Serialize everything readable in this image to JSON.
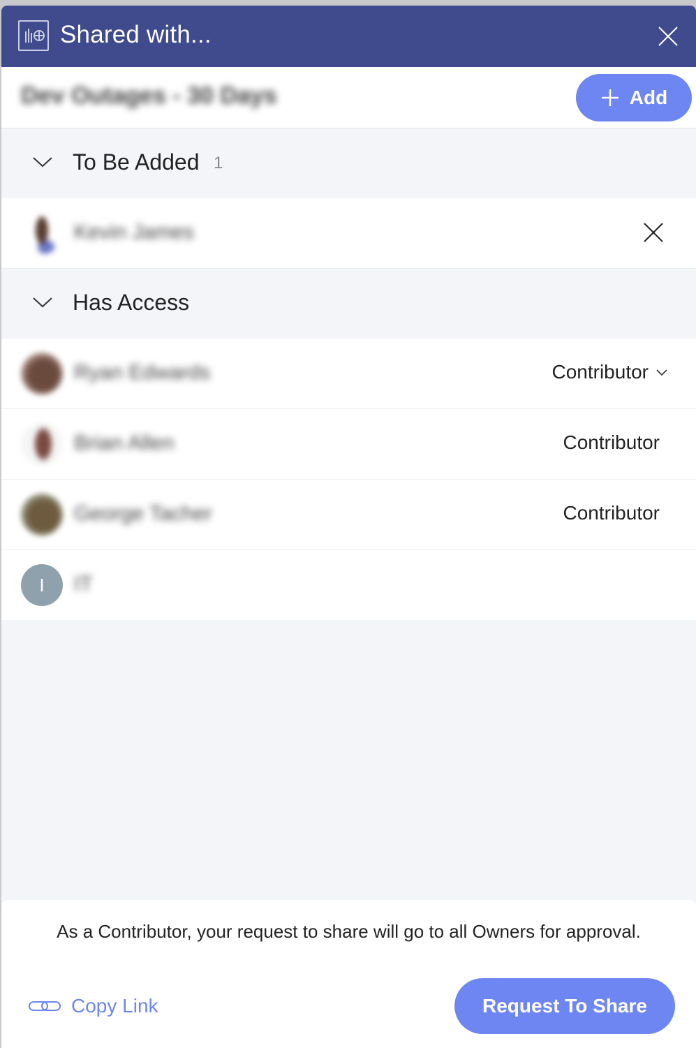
{
  "dialog": {
    "title": "Shared with...",
    "dashboard_name": "Dev Outages - 30 Days"
  },
  "add_button": {
    "label": "Add"
  },
  "sections": {
    "to_be_added": {
      "title": "To Be Added",
      "count": "1"
    },
    "has_access": {
      "title": "Has Access"
    }
  },
  "to_be_added_users": [
    {
      "name": "Kevin James"
    }
  ],
  "has_access_users": [
    {
      "name": "Ryan Edwards",
      "role": "Contributor",
      "dropdown": true
    },
    {
      "name": "Brian Allen",
      "role": "Contributor",
      "dropdown": false
    },
    {
      "name": "George Tacher",
      "role": "Contributor",
      "dropdown": false
    },
    {
      "name": "IT",
      "initial": "I",
      "role": ""
    }
  ],
  "footer": {
    "note": "As a Contributor, your request to share will go to all Owners for approval.",
    "copy_link_label": "Copy Link",
    "request_button_label": "Request To Share"
  },
  "colors": {
    "titlebar": "#3f4b8c",
    "accent": "#6e86f1",
    "background": "#f4f5f9"
  }
}
